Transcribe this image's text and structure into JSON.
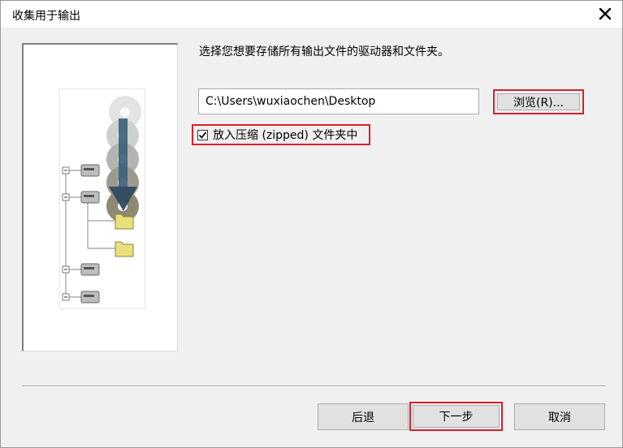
{
  "window": {
    "title": "收集用于输出"
  },
  "instruction": "选择您想要存储所有输出文件的驱动器和文件夹。",
  "path_input": {
    "value": "C:\\Users\\wuxiaochen\\Desktop"
  },
  "browse_button": {
    "label": "浏览(R)..."
  },
  "zip_option": {
    "label": "放入压缩 (zipped) 文件夹中",
    "checked": true
  },
  "buttons": {
    "back": "后退",
    "next": "下一步",
    "cancel": "取消"
  },
  "colors": {
    "highlight": "#d9202a",
    "button_face": "#e1e1e1",
    "dialog_bg": "#f0f0f0"
  },
  "icons": [
    "close-icon",
    "checkmark-icon",
    "cd-disc-icon",
    "arrow-down-icon",
    "drive-icon",
    "folder-icon"
  ]
}
